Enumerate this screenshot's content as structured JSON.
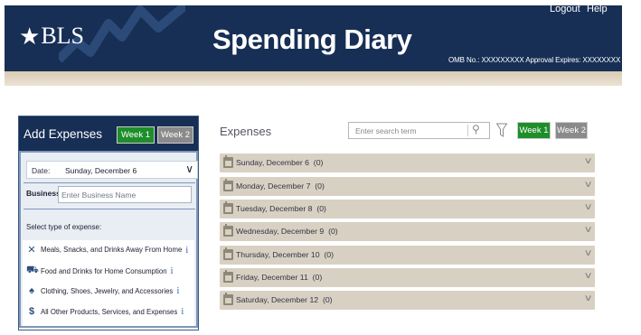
{
  "header": {
    "logo_text": "BLS",
    "app_title": "Spending Diary",
    "logout_label": "Logout",
    "help_label": "Help",
    "omb_text": "OMB No.: XXXXXXXXX  Approval Expires: XXXXXXXX"
  },
  "add_panel": {
    "title": "Add Expenses",
    "week1_label": "Week 1",
    "week2_label": "Week 2",
    "date_label": "Date:",
    "date_value": "Sunday, December 6",
    "business_label": "Business:",
    "business_placeholder": "Enter Business Name",
    "select_type_label": "Select type of expense:",
    "expense_types": [
      {
        "label": "Meals, Snacks, and Drinks Away From Home",
        "icon": "fork-knife-icon"
      },
      {
        "label": "Food and Drinks for Home Consumption",
        "icon": "cart-icon"
      },
      {
        "label": "Clothing, Shoes, Jewelry, and Accessories",
        "icon": "shirt-icon"
      },
      {
        "label": "All Other Products, Services, and Expenses",
        "icon": "dollar-icon"
      }
    ],
    "info_glyph": "i"
  },
  "expenses": {
    "title": "Expenses",
    "search_placeholder": "Enter search term",
    "week1_label": "Week 1",
    "week2_label": "Week 2",
    "days": [
      {
        "label": "Sunday, December 6",
        "count": "(0)"
      },
      {
        "label": "Monday, December 7",
        "count": "(0)"
      },
      {
        "label": "Tuesday, December 8",
        "count": "(0)"
      },
      {
        "label": "Wednesday, December 9",
        "count": "(0)"
      },
      {
        "label": "Thursday, December 10",
        "count": "(0)"
      },
      {
        "label": "Friday, December 11",
        "count": "(0)"
      },
      {
        "label": "Saturday, December 12",
        "count": "(0)"
      }
    ]
  },
  "colors": {
    "header_bg": "#172f55",
    "accent_green": "#1d8e2a",
    "week_grey": "#8a8a8a",
    "day_row_bg": "#d8d1c3",
    "tan_bar": "#e2d7c4"
  }
}
